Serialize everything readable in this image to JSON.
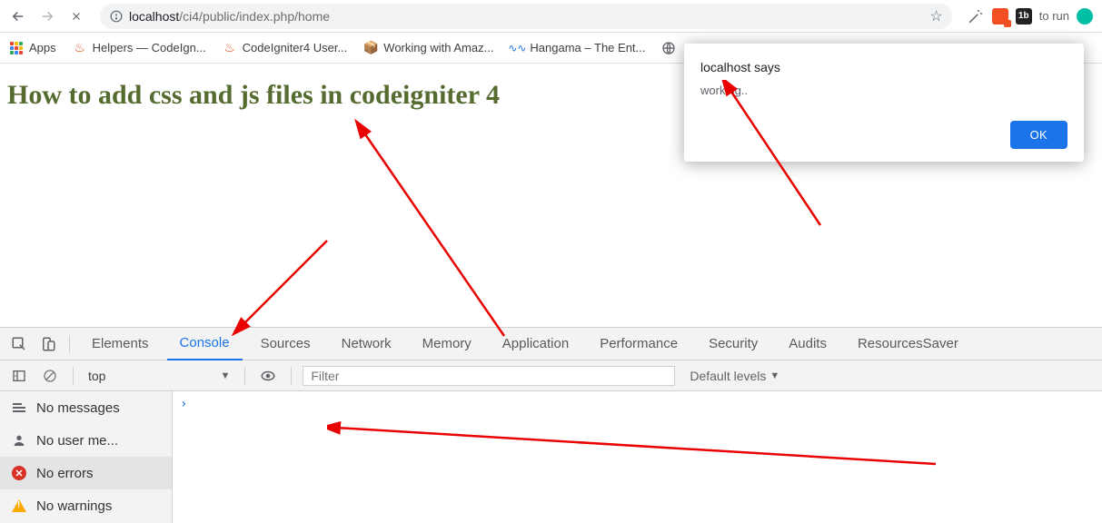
{
  "nav": {
    "url_host": "localhost",
    "url_path": "/ci4/public/index.php/home"
  },
  "right_trunc": "to run",
  "bookmarks": {
    "apps": "Apps",
    "helpers": "Helpers — CodeIgn...",
    "ci4user": "CodeIgniter4 User...",
    "amazon": "Working with Amaz...",
    "hangama": "Hangama – The Ent..."
  },
  "page": {
    "heading": "How to add css and js files in codeigniter 4"
  },
  "alert": {
    "title": "localhost says",
    "message": "working..",
    "ok": "OK"
  },
  "devtools": {
    "tabs": {
      "elements": "Elements",
      "console": "Console",
      "sources": "Sources",
      "network": "Network",
      "memory": "Memory",
      "application": "Application",
      "performance": "Performance",
      "security": "Security",
      "audits": "Audits",
      "resources": "ResourcesSaver"
    },
    "context": "top",
    "filter_placeholder": "Filter",
    "levels": "Default levels",
    "sidebar": {
      "messages": "No messages",
      "user": "No user me...",
      "errors": "No errors",
      "warnings": "No warnings"
    },
    "prompt": "›"
  }
}
